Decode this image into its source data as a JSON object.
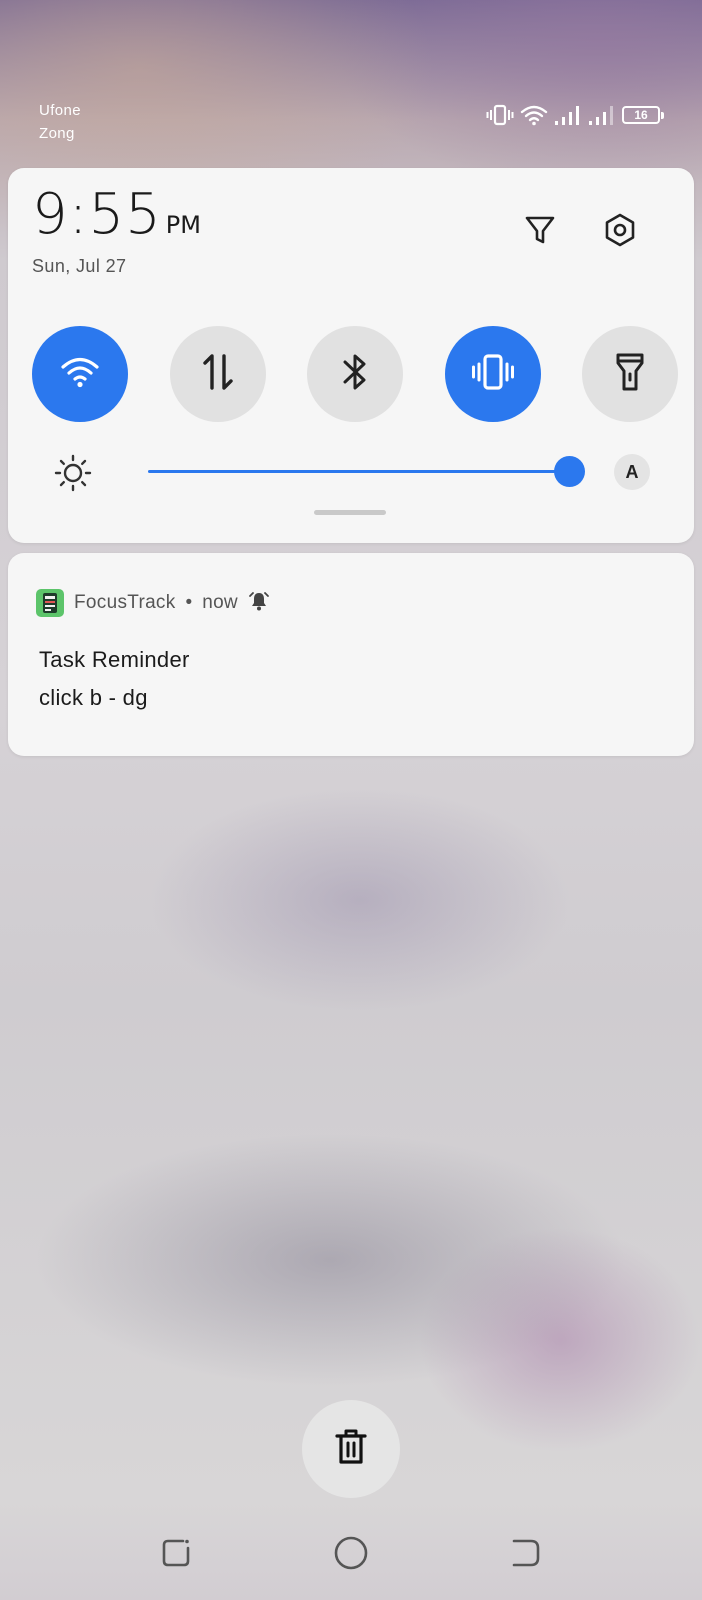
{
  "status_bar": {
    "carrier_1": "Ufone",
    "carrier_2": "Zong",
    "battery_level": "16",
    "icons": [
      "vibrate-icon",
      "wifi-icon",
      "signal-icon",
      "signal-icon",
      "battery-icon"
    ]
  },
  "quick_settings": {
    "time": "9:55",
    "ampm": "PM",
    "date": "Sun, Jul 27",
    "header_icons": [
      "filter-icon",
      "settings-icon"
    ],
    "tiles": [
      {
        "name": "wifi",
        "icon": "wifi-icon",
        "active": true
      },
      {
        "name": "mobile-data",
        "icon": "data-arrows-icon",
        "active": false
      },
      {
        "name": "bluetooth",
        "icon": "bluetooth-icon",
        "active": false
      },
      {
        "name": "vibrate",
        "icon": "vibrate-icon",
        "active": true
      },
      {
        "name": "flashlight",
        "icon": "flashlight-icon",
        "active": false
      }
    ],
    "brightness": {
      "level": 0.97,
      "auto_label": "A"
    },
    "accent_color": "#2b78ee"
  },
  "notification": {
    "app_name": "FocusTrack",
    "separator": "•",
    "time": "now",
    "title": "Task Reminder",
    "text": "click b - dg"
  },
  "actions": {
    "clear_icon": "trash-icon"
  },
  "navigation": {
    "buttons": [
      "recents-icon",
      "home-icon",
      "back-icon"
    ]
  }
}
